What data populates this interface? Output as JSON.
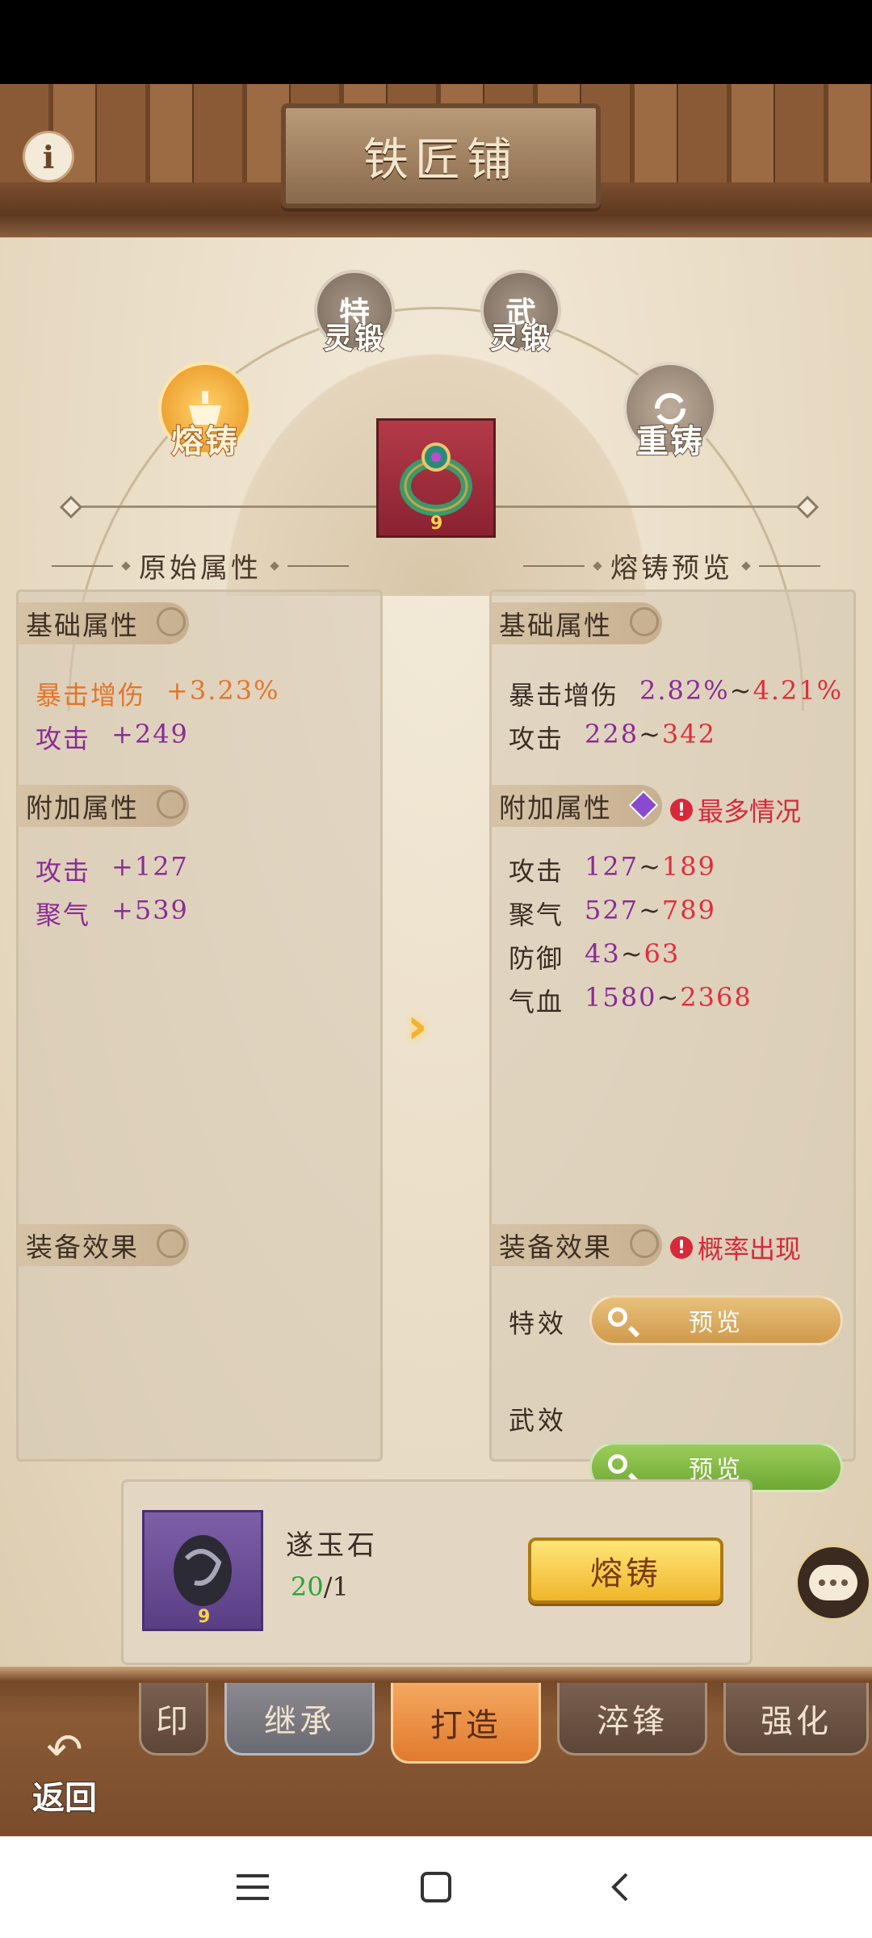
{
  "header": {
    "title": "铁匠铺",
    "info_icon": "info-icon"
  },
  "modes": {
    "special_forge": {
      "badge": "特",
      "label": "灵锻"
    },
    "martial_forge": {
      "badge": "武",
      "label": "灵锻"
    },
    "smelt": {
      "label": "熔铸"
    },
    "reforge": {
      "label": "重铸"
    }
  },
  "item": {
    "level": "9"
  },
  "left": {
    "heading": "原始属性",
    "base_tag": "基础属性",
    "base_attrs": [
      {
        "name": "暴击增伤",
        "value": "+3.23%"
      },
      {
        "name": "攻击",
        "value": "+249"
      }
    ],
    "extra_tag": "附加属性",
    "extra_attrs": [
      {
        "name": "攻击",
        "value": "+127"
      },
      {
        "name": "聚气",
        "value": "+539"
      }
    ],
    "effect_tag": "装备效果"
  },
  "right": {
    "heading": "熔铸预览",
    "base_tag": "基础属性",
    "base_attrs": [
      {
        "name": "暴击增伤",
        "min": "2.82%",
        "sep": "~",
        "max": "4.21%"
      },
      {
        "name": "攻击",
        "min": "228",
        "sep": "~",
        "max": "342"
      }
    ],
    "extra_tag": "附加属性",
    "extra_warn": "最多情况",
    "extra_attrs": [
      {
        "name": "攻击",
        "min": "127",
        "sep": "~",
        "max": "189"
      },
      {
        "name": "聚气",
        "min": "527",
        "sep": "~",
        "max": "789"
      },
      {
        "name": "防御",
        "min": "43",
        "sep": "~",
        "max": "63"
      },
      {
        "name": "气血",
        "min": "1580",
        "sep": "~",
        "max": "2368"
      }
    ],
    "effect_tag": "装备效果",
    "effect_warn": "概率出现",
    "special": {
      "label": "特效",
      "button": "预览"
    },
    "martial": {
      "label": "武效",
      "button": "预览"
    },
    "warn_mark": "!"
  },
  "material": {
    "name": "遂玉石",
    "have": "20",
    "sep": "/",
    "need": "1",
    "level": "9"
  },
  "forge_button": "熔铸",
  "tabs": [
    "印",
    "继承",
    "打造",
    "淬锋",
    "强化"
  ],
  "back": {
    "label": "返回",
    "arrow": "↶"
  },
  "colors": {
    "purple": "#8a2c96",
    "orange": "#e4752a",
    "red": "#e12e3c",
    "green": "#2aa63a",
    "accent": "#e07a2e"
  }
}
